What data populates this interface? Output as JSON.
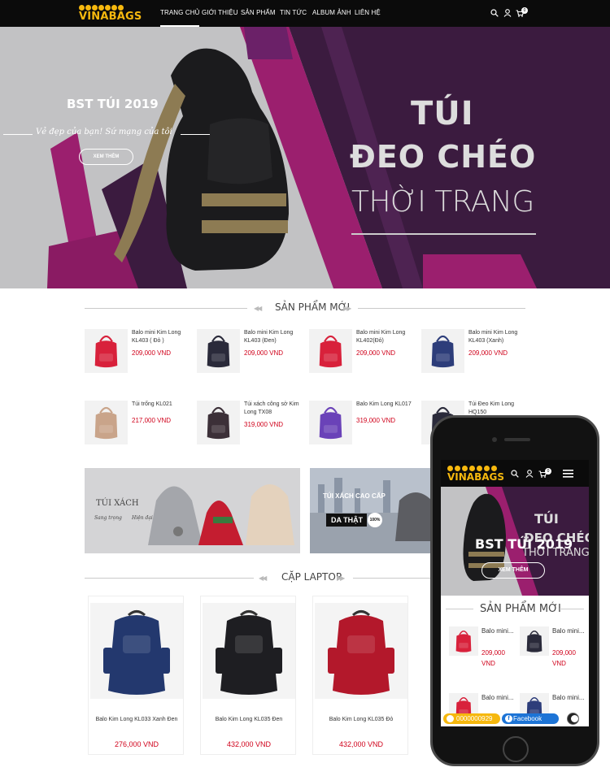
{
  "header": {
    "logo_text": "VINABAGS",
    "nav": [
      {
        "label": "Trang chủ",
        "active": true
      },
      {
        "label": "Giới thiệu",
        "active": false
      },
      {
        "label": "Sản phẩm",
        "active": false
      },
      {
        "label": "Tin tức",
        "active": false
      },
      {
        "label": "Album ảnh",
        "active": false
      },
      {
        "label": "Liên hệ",
        "active": false
      }
    ],
    "cart_count": "0",
    "icons": [
      "search-icon",
      "user-icon",
      "cart-icon"
    ]
  },
  "hero": {
    "subtitle": "BST TÚI 2019",
    "script_text": "Vẻ đẹp của bạn! Sứ mạng của tôi",
    "button_label": "XEM THÊM",
    "headline_1": "TÚI",
    "headline_2": "ĐEO CHÉO",
    "headline_3": "THỜI TRANG"
  },
  "new_products": {
    "title": "Sản phẩm mới",
    "items": [
      {
        "name": "Balo mini Kim Long KL403 ( Đỏ )",
        "price": "209,000 VND",
        "color": "#d8213b"
      },
      {
        "name": "Balo mini Kim Long KL403 (Đen)",
        "price": "209,000 VND",
        "color": "#2a2a3a"
      },
      {
        "name": "Balo mini Kim Long KL402(Đỏ)",
        "price": "209,000 VND",
        "color": "#d8213b"
      },
      {
        "name": "Balo mini Kim Long KL403 (Xanh)",
        "price": "209,000 VND",
        "color": "#2d3d7a"
      },
      {
        "name": "Túi trống KL021",
        "price": "217,000 VND",
        "color": "#c9a48a"
      },
      {
        "name": "Túi xách công sở Kim Long TX08",
        "price": "319,000 VND",
        "color": "#3c3038"
      },
      {
        "name": "Balo Kim Long KL017",
        "price": "319,000 VND",
        "color": "#6a42b8"
      },
      {
        "name": "Túi Đeo Kim Long HQ150",
        "price": "",
        "color": "#2a2a3a"
      }
    ]
  },
  "banners": {
    "left_title": "TÚI XÁCH",
    "left_script_1": "Sang trọng",
    "left_script_2": "Hiện đại",
    "right_title": "TÚI XÁCH CAO CẤP",
    "right_badge": "DA THẬT",
    "right_percent": "100%"
  },
  "laptop": {
    "title": "Cặp laptop",
    "items": [
      {
        "name": "Balo Kim Long KL033 Xanh Đen",
        "price": "276,000 VND",
        "color": "#23386e"
      },
      {
        "name": "Balo Kim Long KL035 Đen",
        "price": "432,000 VND",
        "color": "#1e1e22"
      },
      {
        "name": "Balo Kim Long KL035 Đỏ",
        "price": "432,000 VND",
        "color": "#b3182b"
      }
    ]
  },
  "mobile": {
    "logo_text": "VINABAGS",
    "cart_count": "0",
    "hero_title": "BST TÚI 2019",
    "hero_button": "XEM THÊM",
    "hero_headline_1": "TÚI",
    "hero_headline_2": "ĐEO CHÉO",
    "hero_headline_3": "THỜI TRANG",
    "section_title": "Sản phẩm mới",
    "items": [
      {
        "name": "Balo mini...",
        "price": "209,000 VND",
        "color": "#d8213b"
      },
      {
        "name": "Balo mini...",
        "price": "209,000 VND",
        "color": "#2a2a3a"
      },
      {
        "name": "Balo mini...",
        "price": "",
        "color": "#d8213b"
      },
      {
        "name": "Balo mini...",
        "price": "",
        "color": "#2d3d7a"
      }
    ],
    "phone_number": "0000000929",
    "facebook_label": "Facebook"
  },
  "colors": {
    "accent": "#f6b80e",
    "price": "#d0021b",
    "hero_purple": "#3b1b3f",
    "hero_magenta": "#9b1f6e"
  }
}
